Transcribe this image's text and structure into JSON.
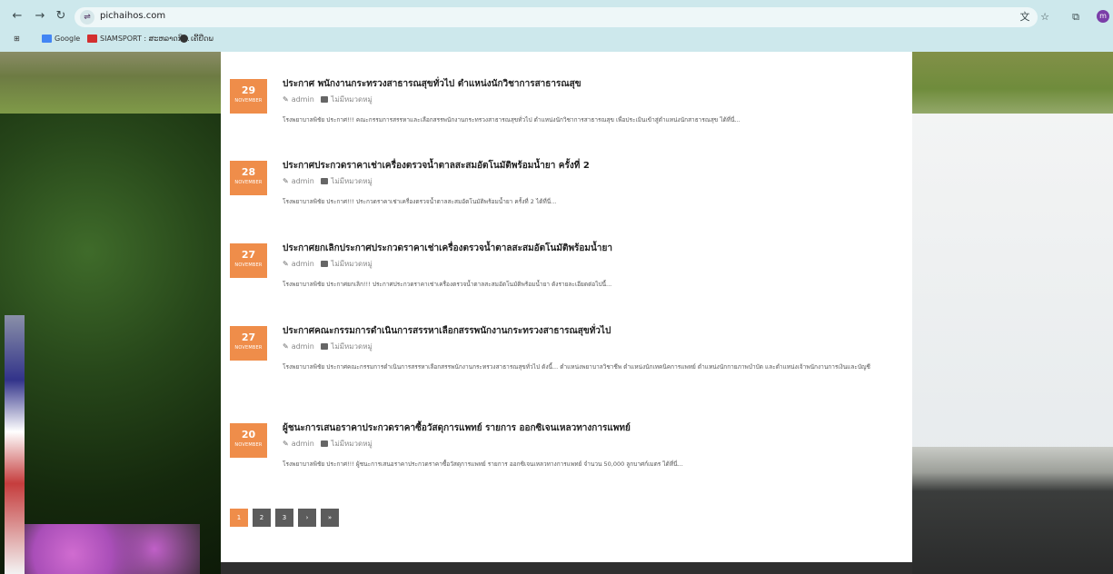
{
  "browser": {
    "url": "pichaihos.com",
    "bookmarks": [
      {
        "label": "Google",
        "color": "#4285f4"
      },
      {
        "label": "SIAMSPORT : ສະຫລາດກີ...",
        "color": "#d32f2f"
      },
      {
        "label": "ເຄີ້ຢືດພ",
        "color": "#333333"
      }
    ],
    "profile_initial": "m"
  },
  "posts": [
    {
      "day": "29",
      "month": "NOVEMBER",
      "title": "ประกาศ พนักงานกระทรวงสาธารณสุขทั่วไป ตำแหน่งนักวิชาการสาธารณสุข",
      "author": "admin",
      "category": "ไม่มีหมวดหมู่",
      "excerpt": "โรงพยาบาลพิชัย ประกาศ!!! คณะกรรมการสรรหาและเลือกสรรพนักงานกระทรวงสาธารณสุขทั่วไป ตำแหน่งนักวิชาการสาธารณสุข เพื่อประเมินเข้าสู่ตำแหน่งนักสาธารณสุข ได้ที่นี่..."
    },
    {
      "day": "28",
      "month": "NOVEMBER",
      "title": "ประกาศประกวดราคาเช่าเครื่องตรวจน้ำตาลสะสมอัตโนมัติพร้อมน้ำยา ครั้งที่ 2",
      "author": "admin",
      "category": "ไม่มีหมวดหมู่",
      "excerpt": "โรงพยาบาลพิชัย ประกาศ!!! ประกวดราคาเช่าเครื่องตรวจน้ำตาลสะสมอัตโนมัติพร้อมน้ำยา ครั้งที่ 2 ได้ที่นี่..."
    },
    {
      "day": "27",
      "month": "NOVEMBER",
      "title": "ประกาศยกเลิกประกาศประกวดราคาเช่าเครื่องตรวจน้ำตาลสะสมอัตโนมัติพร้อมน้ำยา",
      "author": "admin",
      "category": "ไม่มีหมวดหมู่",
      "excerpt": "โรงพยาบาลพิชัย ประกาศยกเลิก!!! ประกาศประกวดราคาเช่าเครื่องตรวจน้ำตาลสะสมอัตโนมัติพร้อมน้ำยา ดังรายละเอียดต่อไปนี้..."
    },
    {
      "day": "27",
      "month": "NOVEMBER",
      "title": "ประกาศคณะกรรมการดำเนินการสรรหาเลือกสรรพนักงานกระทรวงสาธารณสุขทั่วไป",
      "author": "admin",
      "category": "ไม่มีหมวดหมู่",
      "excerpt": "โรงพยาบาลพิชัย ประกาศคณะกรรมการดำเนินการสรรหาเลือกสรรพนักงานกระทรวงสาธารณสุขทั่วไป ดังนี้... ตำแหน่งพยาบาลวิชาชีพ ตำแหน่งนักเทคนิคการแพทย์ ตำแหน่งนักกายภาพบำบัด และตำแหน่งเจ้าพนักงานการเงินและบัญชี"
    },
    {
      "day": "20",
      "month": "NOVEMBER",
      "title": "ผู้ชนะการเสนอราคาประกวดราคาซื้อวัสดุการแพทย์ รายการ ออกซิเจนเหลวทางการแพทย์",
      "author": "admin",
      "category": "ไม่มีหมวดหมู่",
      "excerpt": "โรงพยาบาลพิชัย ประกาศ!!! ผู้ชนะการเสนอราคาประกวดราคาซื้อวัสดุการแพทย์ รายการ ออกซิเจนเหลวทางการแพทย์ จำนวน 50,000 ลูกบาศก์เมตร ได้ที่นี่..."
    }
  ],
  "pagination": {
    "pages": [
      "1",
      "2",
      "3",
      "›",
      "»"
    ],
    "active": "1"
  },
  "colors": {
    "accent": "#ef8d4a",
    "page_button": "#5c5c5c"
  }
}
